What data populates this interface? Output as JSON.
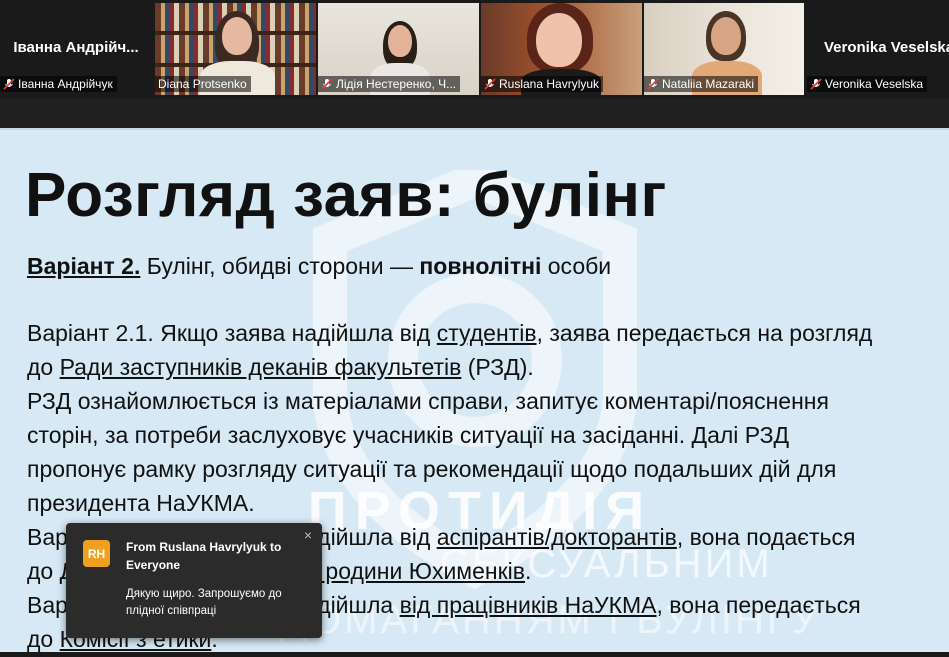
{
  "participants": [
    {
      "display_name": "Іванна  Андрійч...",
      "label": "Іванна Андрійчук",
      "video": false,
      "muted": true
    },
    {
      "label": "Diana Protsenko",
      "video": true,
      "muted": false,
      "active_speaker": true
    },
    {
      "label": "Лідія Нестеренко, Ч...",
      "video": true,
      "muted": true
    },
    {
      "label": "Ruslana Havrylyuk",
      "video": true,
      "muted": true
    },
    {
      "label": "Nataliia Mazaraki",
      "video": true,
      "muted": true
    },
    {
      "display_name": "Veronika Veselska",
      "label": "Veronika Veselska",
      "video": false,
      "muted": true
    }
  ],
  "slide": {
    "title": "Розгляд заяв: булінг",
    "variant": {
      "label": "Варіант 2.",
      "text_before": " Булінг, обидві сторони — ",
      "bold": "повнолітні",
      "text_after": " особи"
    },
    "lines": [
      [
        "Варіант 2.1. Якщо заява надійшла від ",
        {
          "u": "студентів"
        },
        ", заява передається на розгляд"
      ],
      [
        "до ",
        {
          "u": "Ради заступників деканів факультетів"
        },
        " (РЗД)."
      ],
      [
        "РЗД ознайомлюється із матеріалами справи, запитує коментарі/пояснення"
      ],
      [
        "сторін, за потреби заслуховує учасників ситуації на засіданні. Далі РЗД"
      ],
      [
        "пропонує рамку розгляду ситуації та рекомендації щодо подальших дій для"
      ],
      [
        "президента НаУКМА."
      ],
      [
        "Варіант 2.2. Якщо заява надійшла від ",
        {
          "u": "аспірантів/докторантів"
        },
        ", вона подається"
      ],
      [
        "до ",
        {
          "u": "Докторської школи імені родини Юхименків"
        },
        "."
      ],
      [
        "Варіант 2.3. Якщо заява надійшла ",
        {
          "u": "від працівників НаУКМА"
        },
        ", вона передається"
      ],
      [
        "до ",
        {
          "u": "Комісії з етики"
        },
        "."
      ]
    ],
    "watermark": {
      "title": "ПРОТИДІЯ",
      "line1": "СЕКСУАЛЬНИМ",
      "line2": "ДОМАГАННЯМ І БУЛІНГУ"
    }
  },
  "chat_toast": {
    "avatar_initials": "RH",
    "avatar_color": "#f0a020",
    "from": "From Ruslana Havrylyuk to Everyone",
    "message": "Дякую щиро. Запрошуємо до плідної співпраці",
    "close_icon": "×"
  },
  "colors": {
    "slide_bg": "#d7e9f5",
    "active_speaker": "#6fd66f",
    "muted_mic": "#e0403a"
  }
}
